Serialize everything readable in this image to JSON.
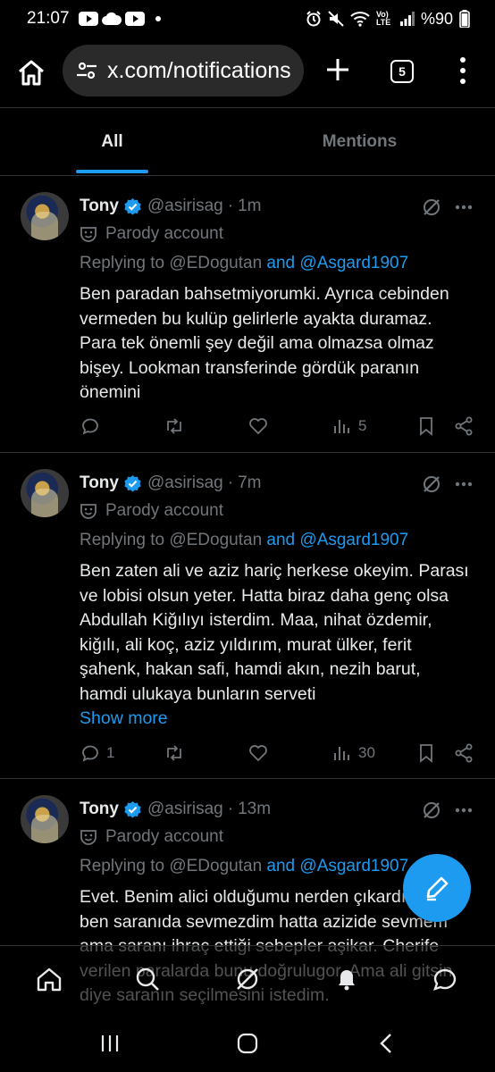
{
  "status_bar": {
    "time": "21:07",
    "battery": "%90",
    "network": "Vo) LTE"
  },
  "browser": {
    "url": "x.com/notifications",
    "tab_count": "5"
  },
  "tabs": [
    {
      "label": "All",
      "selected": true
    },
    {
      "label": "Mentions",
      "selected": false
    }
  ],
  "tweets": [
    {
      "name": "Tony",
      "handle": "@asirisag",
      "separator": "·",
      "time": "1m",
      "parody": "Parody account",
      "replying_prefix": "Replying to",
      "reply_user1": "@EDogutan",
      "reply_and": "and",
      "reply_user2": "@Asgard1907",
      "text": "Ben paradan bahsetmiyorumki. Ayrıca cebinden vermeden bu kulüp gelirlerle ayakta duramaz. Para tek önemli şey değil ama olmazsa olmaz bişey. Lookman transferinde gördük paranın önemini",
      "show_more": "",
      "reply_count": "",
      "views": "5"
    },
    {
      "name": "Tony",
      "handle": "@asirisag",
      "separator": "·",
      "time": "7m",
      "parody": "Parody account",
      "replying_prefix": "Replying to",
      "reply_user1": "@EDogutan",
      "reply_and": "and",
      "reply_user2": "@Asgard1907",
      "text": "Ben zaten ali ve aziz hariç herkese okeyim. Parası ve lobisi olsun yeter. Hatta biraz daha genç olsa Abdullah Kiğılıyı isterdim. Maa, nihat özdemir, kiğılı, ali koç, aziz yıldırım, murat ülker, ferit şahenk, hakan safi, hamdi akın, nezih barut, hamdi ulukaya bunların serveti",
      "show_more": "Show more",
      "reply_count": "1",
      "views": "30"
    },
    {
      "name": "Tony",
      "handle": "@asirisag",
      "separator": "·",
      "time": "13m",
      "parody": "Parody account",
      "replying_prefix": "Replying to",
      "reply_user1": "@EDogutan",
      "reply_and": "and",
      "reply_user2": "@Asgard1907",
      "text": "Evet. Benim alici olduğumu nerden çıkardın ki 🤣 ben saranıda sevmezdim hatta azizide sevmem ama saranı ihraç ettiği sebepler aşikar. Cherife verilen paralarda bunu doğrulugor. Ama ali gitsin diye saranın seçilmesini istedim.",
      "show_more": "",
      "reply_count": "",
      "views": ""
    }
  ],
  "icons": {
    "home": "home-icon",
    "search": "search-icon",
    "grok": "grok-icon",
    "notifications": "bell-icon",
    "messages": "messages-icon",
    "compose": "compose-icon"
  },
  "colors": {
    "accent": "#1d9bf0",
    "background": "#000000",
    "muted": "#71767b",
    "divider": "#2f3336"
  }
}
